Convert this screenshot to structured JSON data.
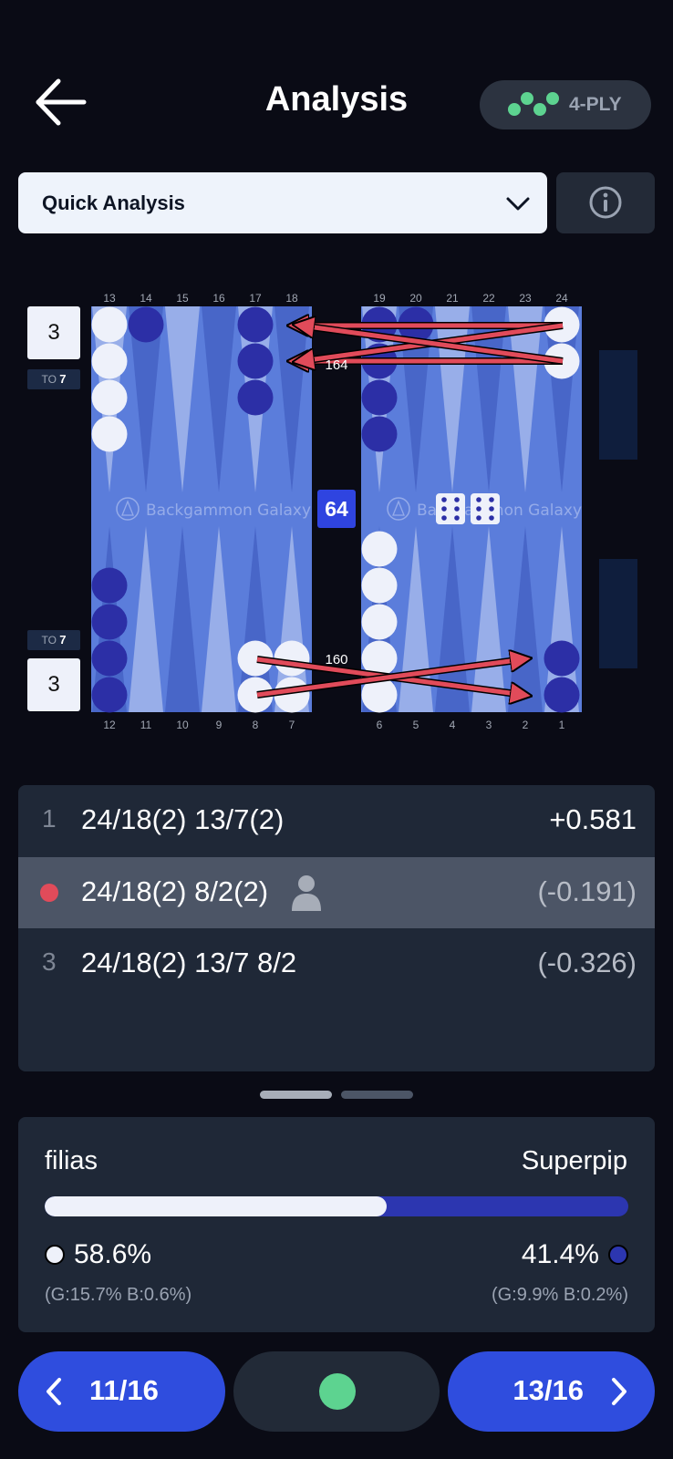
{
  "header": {
    "title": "Analysis",
    "back_icon": "arrow-left-icon",
    "ply_label": "4-PLY",
    "ply_icon": "ply-dots-icon",
    "ply_color": "#5dd390"
  },
  "analysis_select": {
    "value": "Quick Analysis",
    "icon": "chevron-down-icon"
  },
  "info_button": {
    "icon": "info-icon"
  },
  "board": {
    "brand": "Backgammon Galaxy",
    "top_points": [
      "13",
      "14",
      "15",
      "16",
      "17",
      "18",
      "19",
      "20",
      "21",
      "22",
      "23",
      "24"
    ],
    "bottom_points": [
      "12",
      "11",
      "10",
      "9",
      "8",
      "7",
      "6",
      "5",
      "4",
      "3",
      "2",
      "1"
    ],
    "cube_top": {
      "value": "3",
      "to_label": "TO",
      "to_value": "7"
    },
    "cube_bottom": {
      "value": "3",
      "to_label": "TO",
      "to_value": "7"
    },
    "center_pips": "64",
    "pip_top": "164",
    "pip_bottom": "160",
    "dice": [
      6,
      6
    ],
    "colors": {
      "board": "#5b7ddb",
      "point_light": "#98aee9",
      "point_dark": "#4866c8",
      "checker_white": "#eef1fa",
      "checker_blue": "#2c2fa6",
      "arrow": "#e14b5a"
    }
  },
  "moves": [
    {
      "rank": "1",
      "move": "24/18(2) 13/7(2)",
      "equity": "+0.581",
      "selected": false
    },
    {
      "rank": "",
      "move": "24/18(2) 8/2(2)",
      "equity": "(-0.191)",
      "selected": true,
      "user_icon": "user-icon"
    },
    {
      "rank": "3",
      "move": "24/18(2) 13/7 8/2",
      "equity": "(-0.326)",
      "selected": false
    }
  ],
  "stats": {
    "player1": "filias",
    "player2": "Superpip",
    "win1": "58.6%",
    "win2": "41.4%",
    "win1_fraction": 0.586,
    "detail1": "(G:15.7% B:0.6%)",
    "detail2": "(G:9.9% B:0.2%)"
  },
  "nav": {
    "prev_label": "11/16",
    "next_label": "13/16",
    "prev_icon": "chevron-left-icon",
    "next_icon": "chevron-right-icon",
    "mid_icon": "status-dot-icon"
  }
}
